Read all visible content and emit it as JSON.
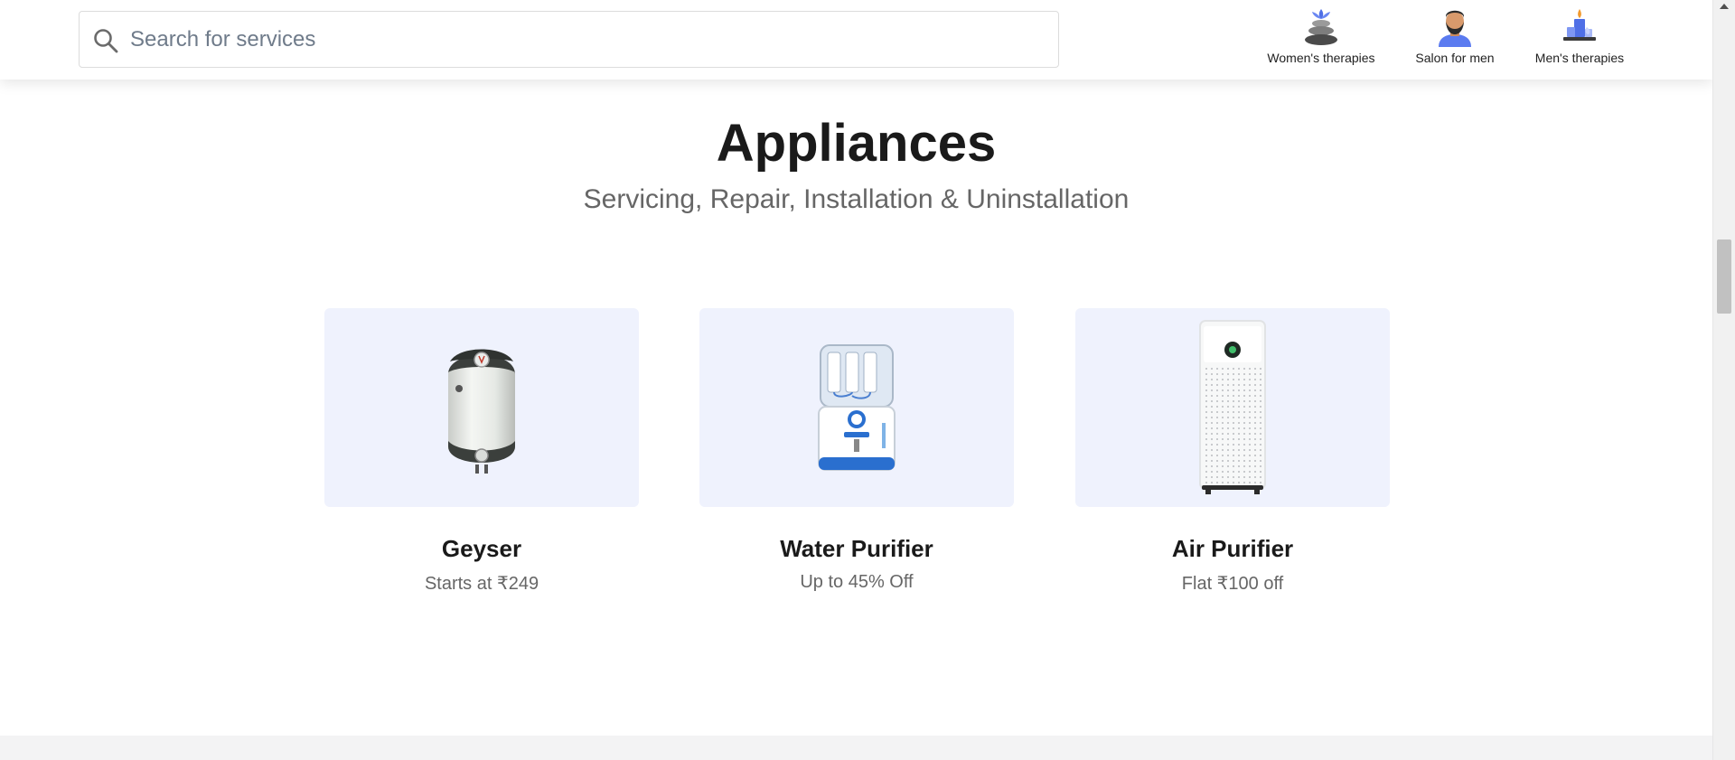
{
  "header": {
    "search": {
      "placeholder": "Search for services",
      "value": ""
    },
    "shortcuts": [
      {
        "label": "Women's therapies",
        "icon": "stones-lotus-icon"
      },
      {
        "label": "Salon for men",
        "icon": "man-avatar-icon"
      },
      {
        "label": "Men's therapies",
        "icon": "candle-icon"
      }
    ]
  },
  "section": {
    "title": "Appliances",
    "subtitle": "Servicing, Repair, Installation & Uninstallation",
    "cards": [
      {
        "name": "Geyser",
        "offer": "Starts at ₹249",
        "icon": "geyser-icon"
      },
      {
        "name": "Water Purifier",
        "offer": "Up to 45% Off",
        "icon": "water-purifier-icon"
      },
      {
        "name": "Air Purifier",
        "offer": "Flat ₹100 off",
        "icon": "air-purifier-icon"
      }
    ]
  },
  "colors": {
    "card_bg": "#eff2fd",
    "title": "#1a1a1a",
    "subtitle": "#666666",
    "accent_blue": "#5b7bf0"
  }
}
